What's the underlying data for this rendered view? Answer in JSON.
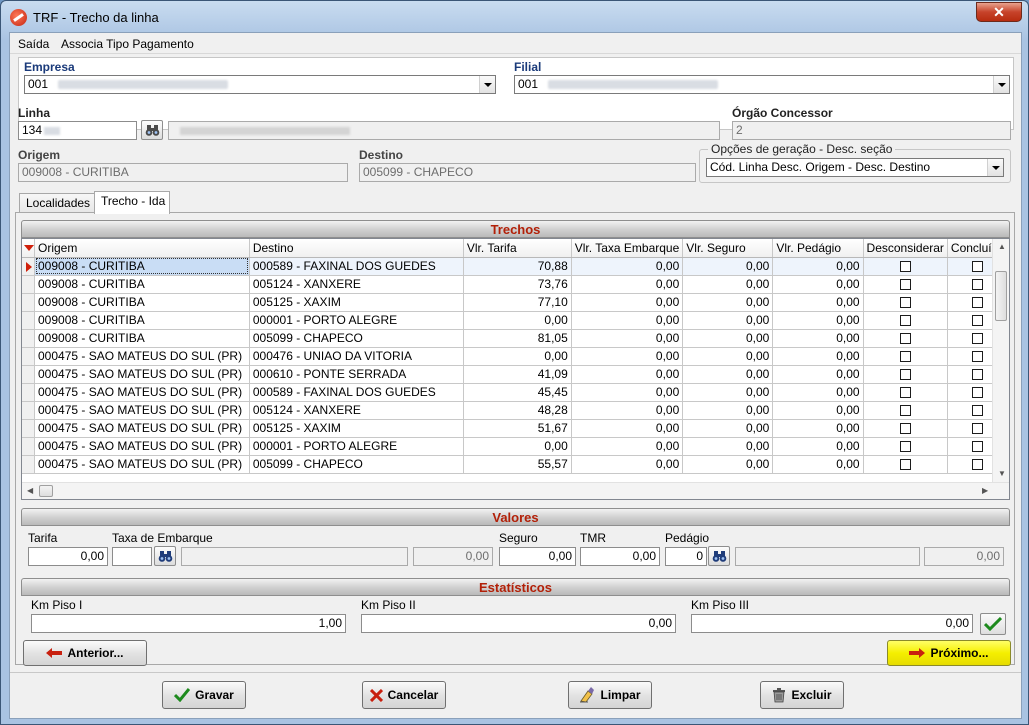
{
  "window": {
    "title": "TRF - Trecho da linha",
    "close_label": "✕"
  },
  "menu": {
    "items": [
      "Saída",
      "Associa Tipo Pagamento"
    ]
  },
  "header": {
    "empresa_label": "Empresa",
    "empresa_value": "001",
    "filial_label": "Filial",
    "filial_value": "001",
    "linha_label": "Linha",
    "linha_value": "134",
    "orgao_label": "Órgão Concessor",
    "orgao_value": "2",
    "origem_label": "Origem",
    "origem_value": "009008 - CURITIBA",
    "destino_label": "Destino",
    "destino_value": "005099 - CHAPECO",
    "opcoes_label": "Opções de geração - Desc. seção",
    "opcoes_value": "Cód. Linha Desc. Origem - Desc. Destino"
  },
  "tabs": [
    "Localidades",
    "Trecho - Ida"
  ],
  "trechos": {
    "title": "Trechos",
    "columns": [
      "Origem",
      "Destino",
      "Vlr. Tarifa",
      "Vlr. Taxa Embarque",
      "Vlr. Seguro",
      "Vlr. Pedágio",
      "Desconsiderar",
      "Concluído"
    ],
    "rows": [
      {
        "origem": "009008 - CURITIBA",
        "destino": "000589 - FAXINAL DOS GUEDES",
        "tarifa": "70,88",
        "taxa": "0,00",
        "seguro": "0,00",
        "pedagio": "0,00"
      },
      {
        "origem": "009008 - CURITIBA",
        "destino": "005124 - XANXERE",
        "tarifa": "73,76",
        "taxa": "0,00",
        "seguro": "0,00",
        "pedagio": "0,00"
      },
      {
        "origem": "009008 - CURITIBA",
        "destino": "005125 - XAXIM",
        "tarifa": "77,10",
        "taxa": "0,00",
        "seguro": "0,00",
        "pedagio": "0,00"
      },
      {
        "origem": "009008 - CURITIBA",
        "destino": "000001 - PORTO ALEGRE",
        "tarifa": "0,00",
        "taxa": "0,00",
        "seguro": "0,00",
        "pedagio": "0,00"
      },
      {
        "origem": "009008 - CURITIBA",
        "destino": "005099 - CHAPECO",
        "tarifa": "81,05",
        "taxa": "0,00",
        "seguro": "0,00",
        "pedagio": "0,00"
      },
      {
        "origem": "000475 - SAO MATEUS DO SUL (PR)",
        "destino": "000476 - UNIAO DA VITORIA",
        "tarifa": "0,00",
        "taxa": "0,00",
        "seguro": "0,00",
        "pedagio": "0,00"
      },
      {
        "origem": "000475 - SAO MATEUS DO SUL (PR)",
        "destino": "000610 - PONTE SERRADA",
        "tarifa": "41,09",
        "taxa": "0,00",
        "seguro": "0,00",
        "pedagio": "0,00"
      },
      {
        "origem": "000475 - SAO MATEUS DO SUL (PR)",
        "destino": "000589 - FAXINAL DOS GUEDES",
        "tarifa": "45,45",
        "taxa": "0,00",
        "seguro": "0,00",
        "pedagio": "0,00"
      },
      {
        "origem": "000475 - SAO MATEUS DO SUL (PR)",
        "destino": "005124 - XANXERE",
        "tarifa": "48,28",
        "taxa": "0,00",
        "seguro": "0,00",
        "pedagio": "0,00"
      },
      {
        "origem": "000475 - SAO MATEUS DO SUL (PR)",
        "destino": "005125 - XAXIM",
        "tarifa": "51,67",
        "taxa": "0,00",
        "seguro": "0,00",
        "pedagio": "0,00"
      },
      {
        "origem": "000475 - SAO MATEUS DO SUL (PR)",
        "destino": "000001 - PORTO ALEGRE",
        "tarifa": "0,00",
        "taxa": "0,00",
        "seguro": "0,00",
        "pedagio": "0,00"
      },
      {
        "origem": "000475 - SAO MATEUS DO SUL (PR)",
        "destino": "005099 - CHAPECO",
        "tarifa": "55,57",
        "taxa": "0,00",
        "seguro": "0,00",
        "pedagio": "0,00"
      }
    ]
  },
  "valores": {
    "title": "Valores",
    "tarifa_label": "Tarifa",
    "tarifa_value": "0,00",
    "taxa_label": "Taxa de Embarque",
    "taxa_value": "",
    "taxa_total": "0,00",
    "seguro_label": "Seguro",
    "seguro_value": "0,00",
    "tmr_label": "TMR",
    "tmr_value": "0,00",
    "pedagio_label": "Pedágio",
    "pedagio_value": "0",
    "pedagio_total": "0,00"
  },
  "estatisticos": {
    "title": "Estatísticos",
    "km1_label": "Km Piso I",
    "km1_value": "1,00",
    "km2_label": "Km Piso II",
    "km2_value": "0,00",
    "km3_label": "Km Piso III",
    "km3_value": "0,00"
  },
  "nav": {
    "anterior": "Anterior...",
    "proximo": "Próximo..."
  },
  "actions": {
    "gravar": "Gravar",
    "cancelar": "Cancelar",
    "limpar": "Limpar",
    "excluir": "Excluir"
  }
}
